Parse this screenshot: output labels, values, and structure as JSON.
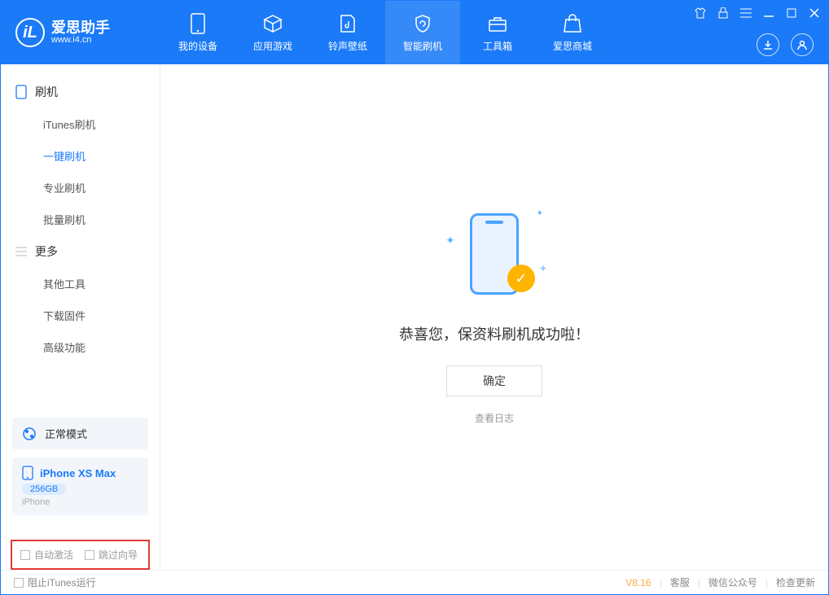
{
  "app": {
    "title": "爱思助手",
    "subtitle": "www.i4.cn"
  },
  "nav": {
    "items": [
      {
        "label": "我的设备"
      },
      {
        "label": "应用游戏"
      },
      {
        "label": "铃声壁纸"
      },
      {
        "label": "智能刷机"
      },
      {
        "label": "工具箱"
      },
      {
        "label": "爱思商城"
      }
    ]
  },
  "sidebar": {
    "group1": {
      "title": "刷机",
      "items": [
        "iTunes刷机",
        "一键刷机",
        "专业刷机",
        "批量刷机"
      ]
    },
    "group2": {
      "title": "更多",
      "items": [
        "其他工具",
        "下载固件",
        "高级功能"
      ]
    },
    "mode": "正常模式",
    "device": {
      "name": "iPhone XS Max",
      "storage": "256GB",
      "type": "iPhone"
    },
    "opts": {
      "auto_activate": "自动激活",
      "skip_guide": "跳过向导"
    }
  },
  "main": {
    "success_text": "恭喜您，保资料刷机成功啦！",
    "ok": "确定",
    "view_log": "查看日志"
  },
  "footer": {
    "block_itunes": "阻止iTunes运行",
    "version": "V8.16",
    "support": "客服",
    "wechat": "微信公众号",
    "update": "检查更新"
  }
}
